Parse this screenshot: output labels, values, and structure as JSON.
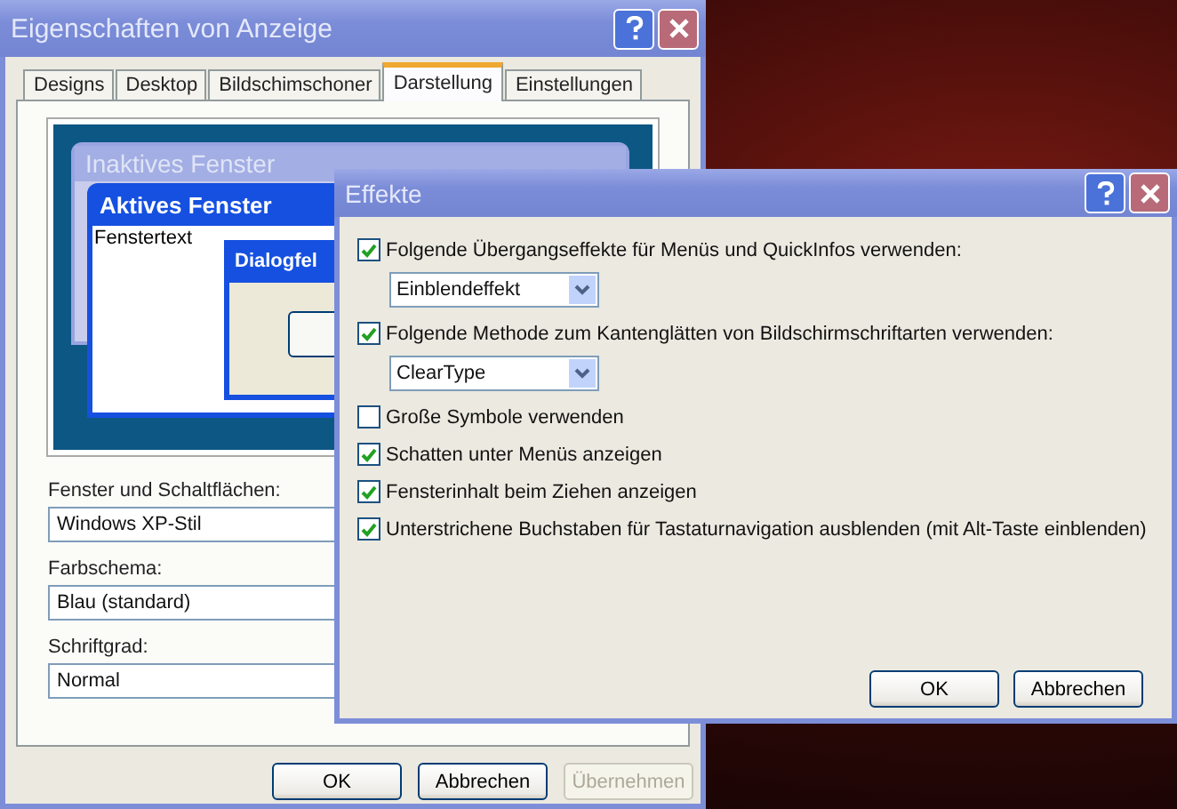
{
  "main_window": {
    "title": "Eigenschaften von Anzeige",
    "tabs": [
      {
        "label": "Designs",
        "selected": false
      },
      {
        "label": "Desktop",
        "selected": false
      },
      {
        "label": "Bildschimschoner",
        "selected": false
      },
      {
        "label": "Darstellung",
        "selected": true
      },
      {
        "label": "Einstellungen",
        "selected": false
      }
    ],
    "preview": {
      "inactive_title": "Inaktives Fenster",
      "active_title": "Aktives Fenster",
      "window_text": "Fenstertext",
      "dialog_title": "Dialogfel"
    },
    "fields": [
      {
        "label": "Fenster und Schaltflächen:",
        "value": "Windows XP-Stil"
      },
      {
        "label": "Farbschema:",
        "value": "Blau (standard)"
      },
      {
        "label": "Schriftgrad:",
        "value": "Normal"
      }
    ],
    "buttons": [
      {
        "label": "OK",
        "disabled": false
      },
      {
        "label": "Abbrechen",
        "disabled": false
      },
      {
        "label": "Übernehmen",
        "disabled": true
      }
    ]
  },
  "effects_dialog": {
    "title": "Effekte",
    "options": [
      {
        "kind": "checkbox",
        "label": "Folgende Übergangseffekte für Menüs und QuickInfos verwenden:",
        "checked": true
      },
      {
        "kind": "dropdown",
        "value": "Einblendeffekt"
      },
      {
        "kind": "checkbox",
        "label": "Folgende Methode zum Kantenglätten von Bildschirmschriftarten verwenden:",
        "checked": true
      },
      {
        "kind": "dropdown",
        "value": "ClearType"
      },
      {
        "kind": "checkbox",
        "label": "Große Symbole verwenden",
        "checked": false
      },
      {
        "kind": "checkbox",
        "label": "Schatten unter Menüs anzeigen",
        "checked": true
      },
      {
        "kind": "checkbox",
        "label": "Fensterinhalt beim Ziehen anzeigen",
        "checked": true
      },
      {
        "kind": "checkbox",
        "label": "Unterstrichene Buchstaben für Tastaturnavigation ausblenden (mit Alt-Taste einblenden)",
        "checked": true
      }
    ],
    "buttons": [
      "OK",
      "Abbrechen"
    ]
  }
}
